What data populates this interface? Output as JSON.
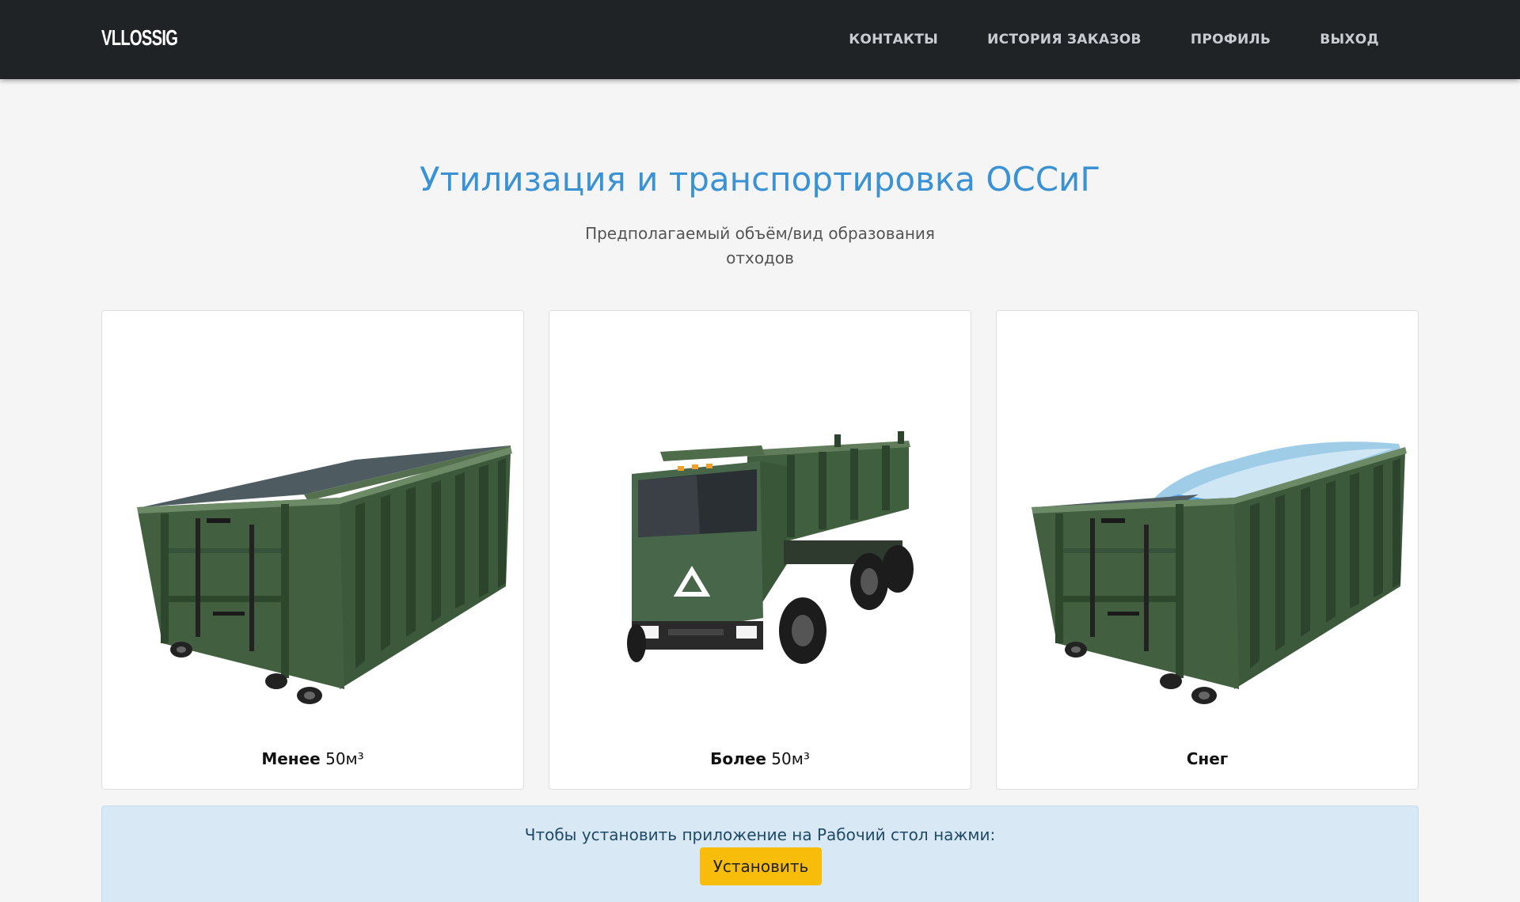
{
  "nav": {
    "logo": "VLLOSSIG",
    "links": [
      "КОНТАКТЫ",
      "ИСТОРИЯ ЗАКАЗОВ",
      "ПРОФИЛЬ",
      "ВЫХОД"
    ]
  },
  "main": {
    "title": "Утилизация и транспортировка ОССиГ",
    "subtitle_line1": "Предполагаемый объём/вид образования",
    "subtitle_line2": "отходов"
  },
  "cards": [
    {
      "label_bold": "Менее",
      "label_rest": " 50м³",
      "image": "empty-container"
    },
    {
      "label_bold": "Более",
      "label_rest": " 50м³",
      "image": "dump-truck"
    },
    {
      "label_bold": "Снег",
      "label_rest": "",
      "image": "snow-container"
    }
  ],
  "install": {
    "text": "Чтобы установить приложение на Рабочий стол нажми:",
    "button": "Установить"
  },
  "colors": {
    "navbar": "#1f2326",
    "title": "#3a92d4",
    "container_green": "#3f5f3e",
    "install_button": "#f7bd0a",
    "alert_bg": "#d8e8f5"
  }
}
